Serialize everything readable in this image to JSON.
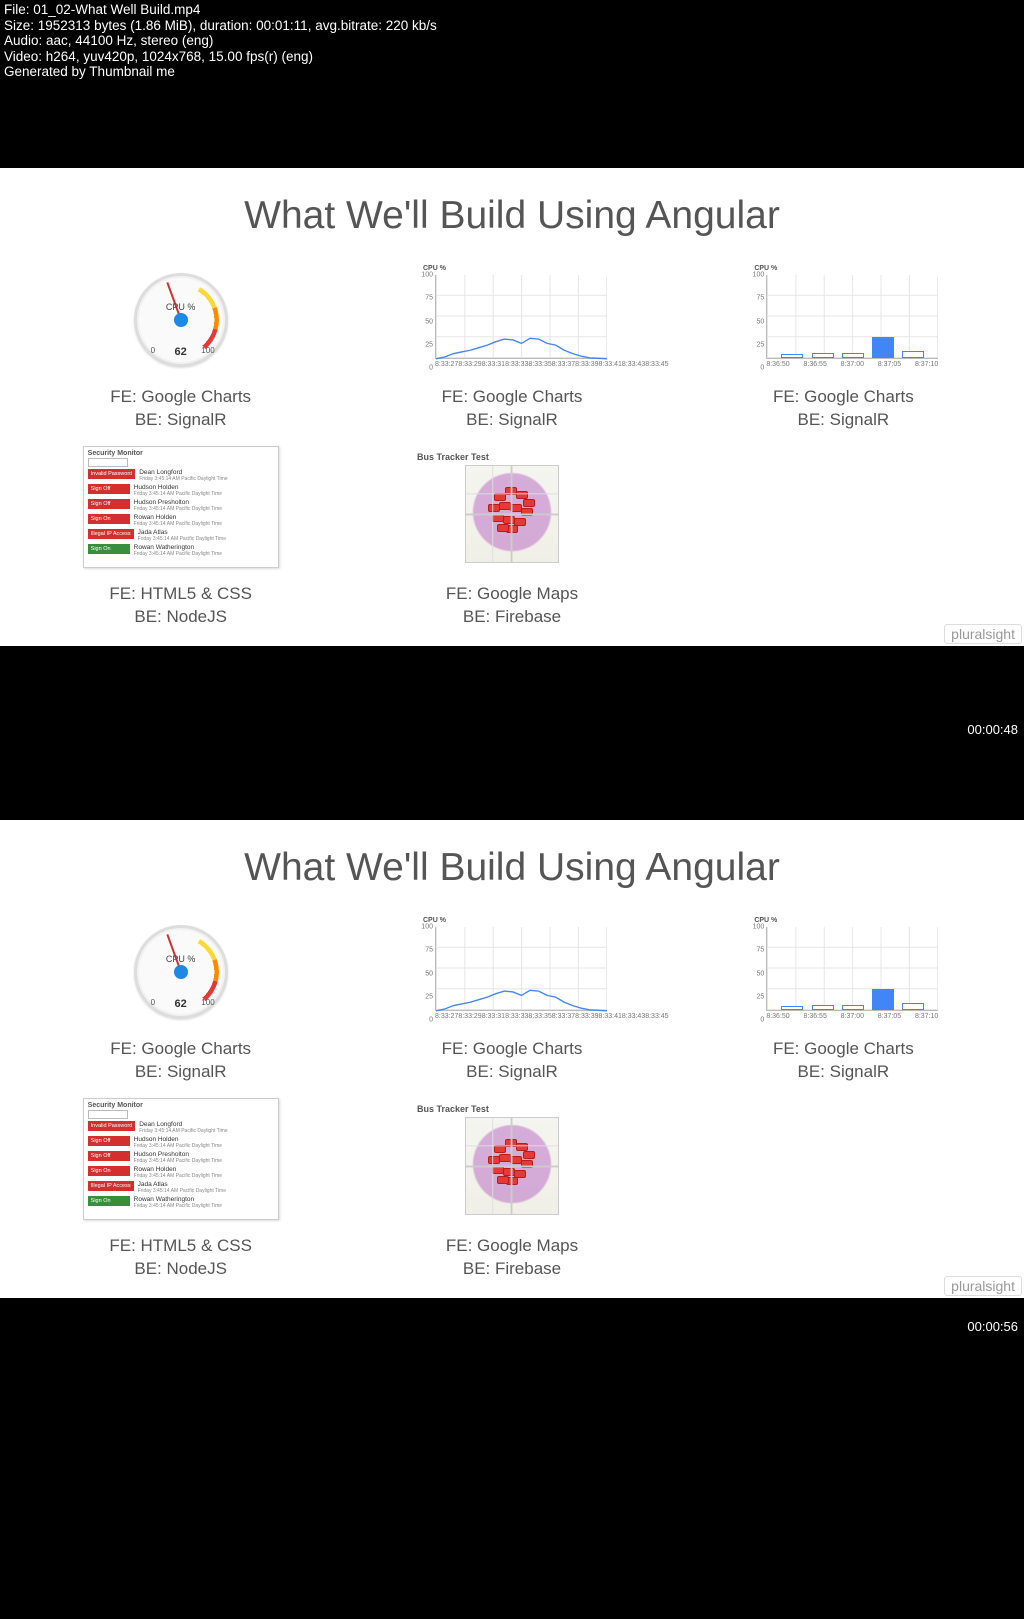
{
  "meta": {
    "file_line": "File: 01_02-What Well Build.mp4",
    "size_line": "Size: 1952313 bytes (1.86 MiB), duration: 00:01:11, avg.bitrate: 220 kb/s",
    "audio_line": "Audio: aac, 44100 Hz, stereo (eng)",
    "video_line": "Video: h264, yuv420p, 1024x768, 15.00 fps(r) (eng)",
    "gen_line": "Generated by Thumbnail me"
  },
  "slide": {
    "title": "What We'll Build Using Angular",
    "watermark": "pluralsight",
    "cards": [
      {
        "fe": "FE:  Google Charts",
        "be": "BE:  SignalR"
      },
      {
        "fe": "FE:  Google Charts",
        "be": "BE:  SignalR"
      },
      {
        "fe": "FE:  Google Charts",
        "be": "BE:  SignalR"
      },
      {
        "fe": "FE:  HTML5 & CSS",
        "be": "BE:  NodeJS"
      },
      {
        "fe": "FE:  Google Maps",
        "be": "BE:  Firebase"
      }
    ]
  },
  "gauge": {
    "label": "CPU %",
    "value": "62",
    "min": "0",
    "max": "100"
  },
  "sec": {
    "title": "Security Monitor",
    "rows": [
      {
        "cls": "red",
        "badge": "Invalid Password",
        "name": "Dean Longford"
      },
      {
        "cls": "red",
        "badge": "Sign Off",
        "name": "Hudson Holden"
      },
      {
        "cls": "red",
        "badge": "Sign Off",
        "name": "Hudson Presholton"
      },
      {
        "cls": "red",
        "badge": "Sign On",
        "name": "Rowan Holden"
      },
      {
        "cls": "red",
        "badge": "Illegal IP Access",
        "name": "Jada Atlas"
      },
      {
        "cls": "green",
        "badge": "Sign On",
        "name": "Rowan Watherington"
      }
    ]
  },
  "map": {
    "title": "Bus Tracker Test"
  },
  "timestamps": {
    "frame1": "00:00:48",
    "frame2": "00:00:56"
  },
  "chart_data": [
    {
      "type": "gauge",
      "title": "CPU %",
      "value": 62,
      "min": 0,
      "max": 100
    },
    {
      "type": "line",
      "title": "CPU %",
      "ylabel": "",
      "ylim": [
        0,
        100
      ],
      "yticks": [
        0,
        25,
        50,
        75,
        100
      ],
      "x": [
        "8:33:27",
        "8:33:29",
        "8:33:31",
        "8:33:33",
        "8:33:35",
        "8:33:37",
        "8:33:39",
        "8:33:41",
        "8:33:43",
        "8:33:45"
      ],
      "values": [
        2,
        4,
        8,
        10,
        12,
        15,
        18,
        22,
        25,
        24,
        20,
        26,
        25,
        20,
        18,
        12,
        8,
        5,
        3,
        2
      ]
    },
    {
      "type": "bar",
      "title": "CPU %",
      "ylabel": "",
      "ylim": [
        0,
        100
      ],
      "yticks": [
        0,
        25,
        50,
        75,
        100
      ],
      "categories": [
        "8:36:50",
        "8:36:55",
        "8:37:00",
        "8:37:05",
        "8:37:10"
      ],
      "values": [
        4,
        6,
        6,
        25,
        8
      ]
    }
  ]
}
